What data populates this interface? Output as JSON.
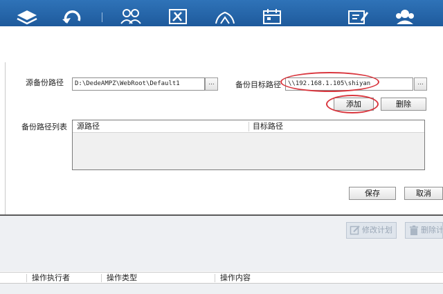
{
  "toolbar": {
    "icons": [
      "layers-icon",
      "undo-icon",
      "users-icon",
      "tools-icon",
      "cloud-icon",
      "calendar-icon",
      "edit-icon",
      "people-icon"
    ]
  },
  "backup_dialog": {
    "source_label": "源备份路径",
    "source_value": "D:\\DedeAMPZ\\WebRoot\\Default1",
    "source_browse": "...",
    "target_label": "备份目标路径",
    "target_value": "\\\\192.168.1.105\\shiyan",
    "target_browse": "...",
    "add_button": "添加",
    "delete_button": "删除",
    "list_label": "备份路径列表",
    "table_columns": [
      "源路径",
      "目标路径"
    ],
    "save_button": "保存",
    "cancel_button": "取消"
  },
  "plan_actions": {
    "modify": "修改计划",
    "delete": "删除计"
  },
  "log_table": {
    "columns": [
      "操作执行者",
      "操作类型",
      "操作内容"
    ]
  },
  "colors": {
    "toolbar": "#2466ab",
    "highlight": "#d9363e",
    "panel": "#eef0f3"
  }
}
